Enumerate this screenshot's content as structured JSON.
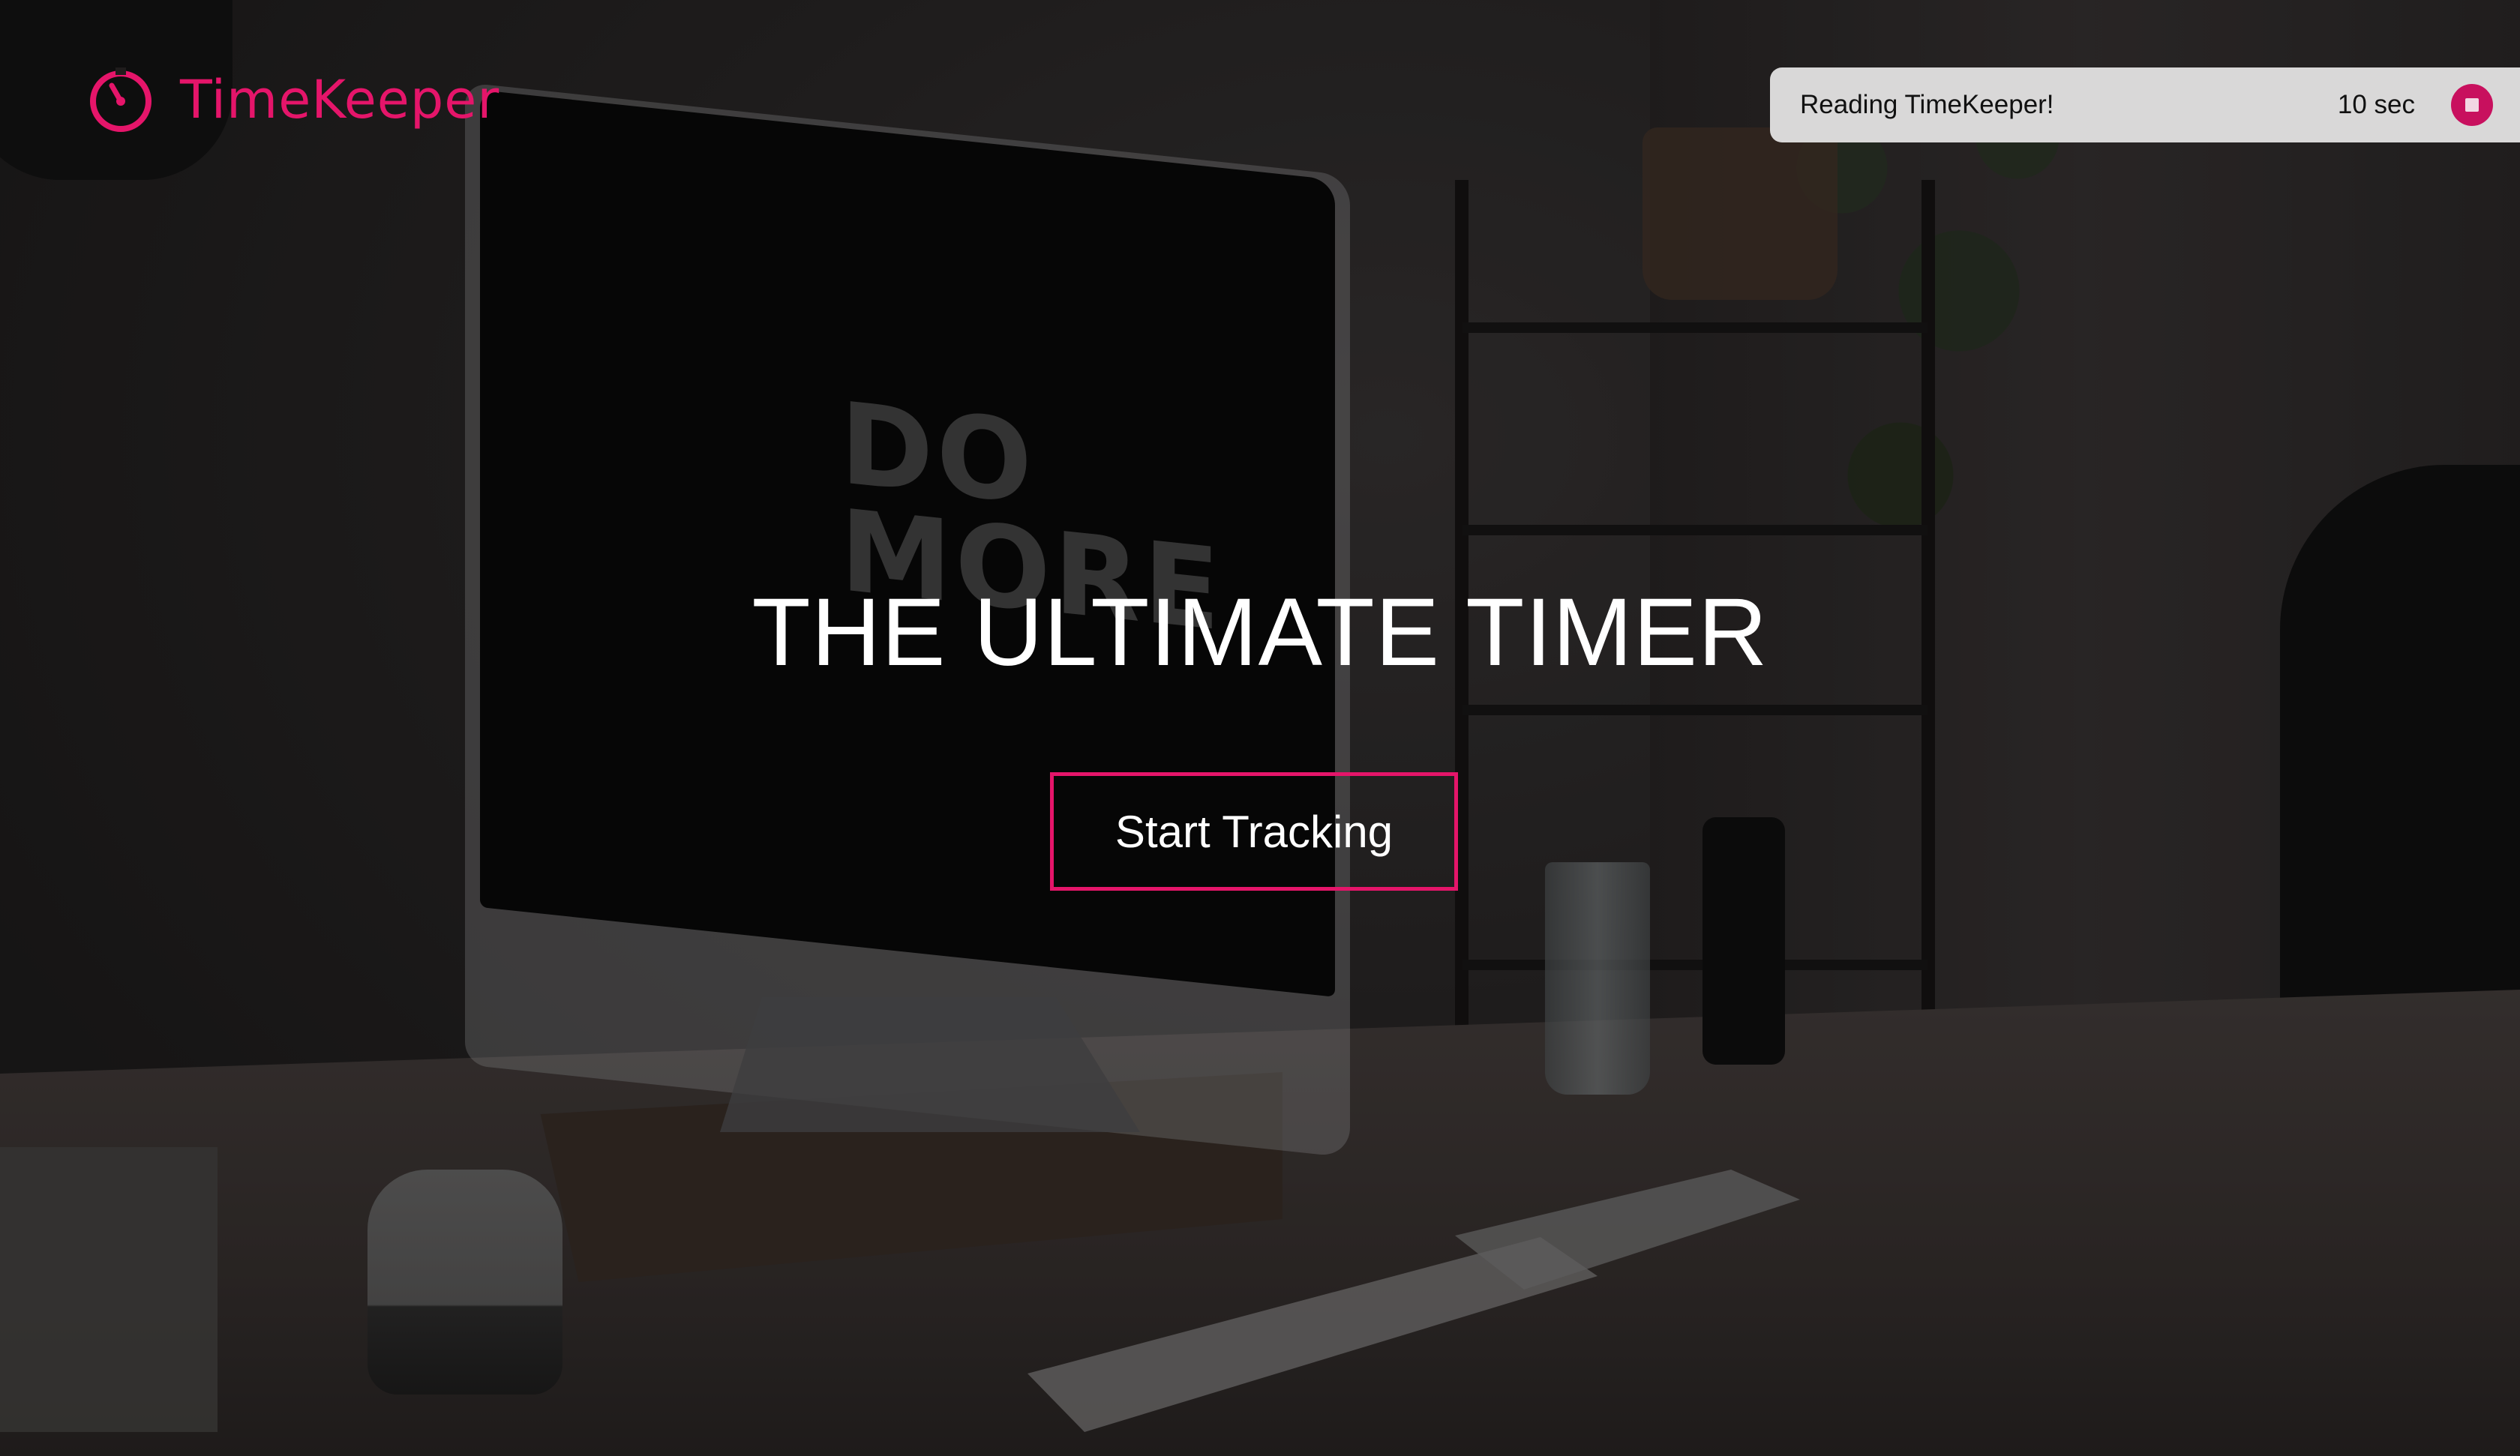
{
  "brand": {
    "name": "TimeKeeper",
    "accent_color": "#e5156a",
    "logo_icon": "stopwatch-icon"
  },
  "reading_widget": {
    "label": "Reading TimeKeeper!",
    "elapsed": "10 sec",
    "stop_icon": "stop-icon",
    "stop_color": "#c8105e"
  },
  "hero": {
    "title": "THE ULTIMATE TIMER",
    "cta_label": "Start Tracking",
    "background_screen_text": "DO MORE"
  }
}
